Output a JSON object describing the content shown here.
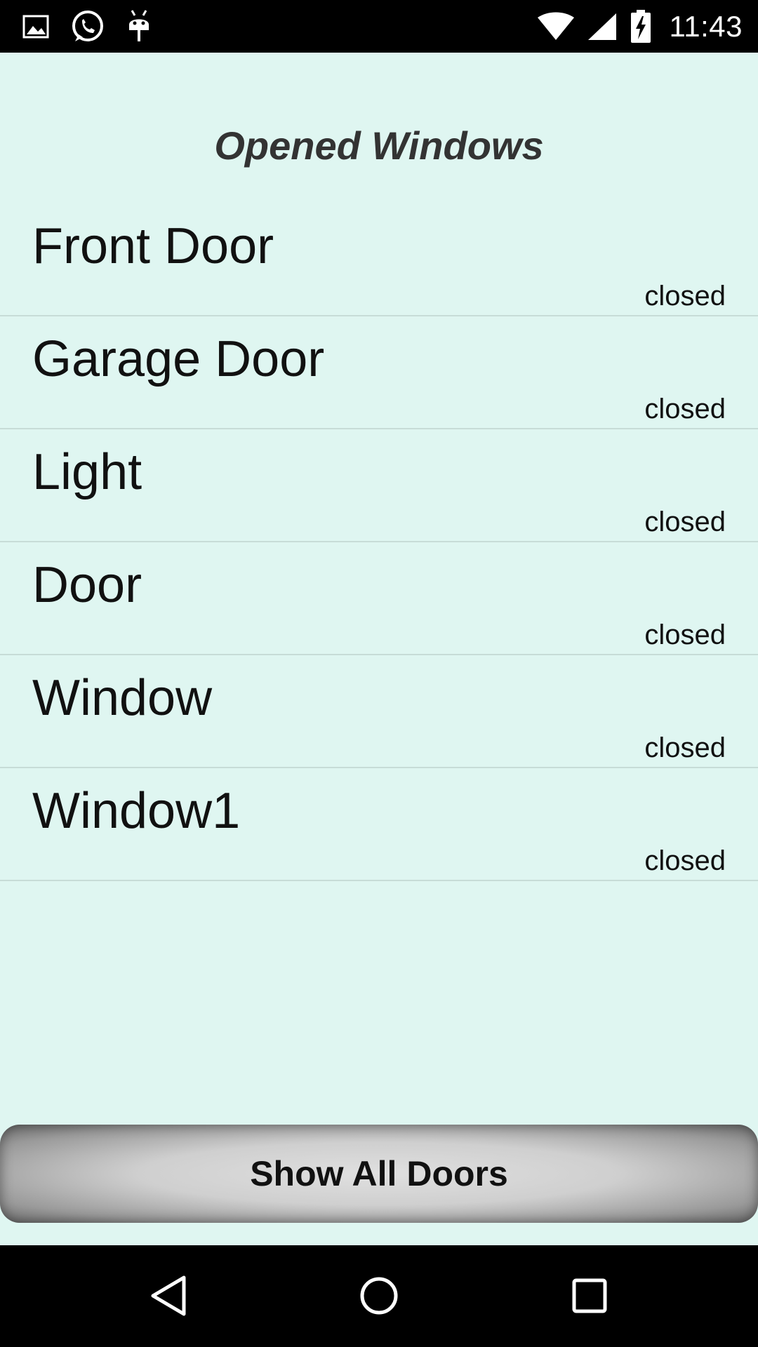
{
  "status_bar": {
    "time": "11:43",
    "icons": [
      "gallery-icon",
      "whatsapp-icon",
      "android-debug-icon",
      "wifi-icon",
      "cell-signal-icon",
      "battery-charging-icon"
    ]
  },
  "page": {
    "title": "Opened Windows"
  },
  "items": [
    {
      "name": "Front Door",
      "status": "closed"
    },
    {
      "name": "Garage Door",
      "status": "closed"
    },
    {
      "name": "Light",
      "status": "closed"
    },
    {
      "name": "Door",
      "status": "closed"
    },
    {
      "name": "Window",
      "status": "closed"
    },
    {
      "name": "Window1",
      "status": "closed"
    }
  ],
  "buttons": {
    "show_all_doors": "Show All Doors"
  },
  "colors": {
    "background": "#dff6f1",
    "divider": "#c7dcd7",
    "bars": "#000000"
  }
}
